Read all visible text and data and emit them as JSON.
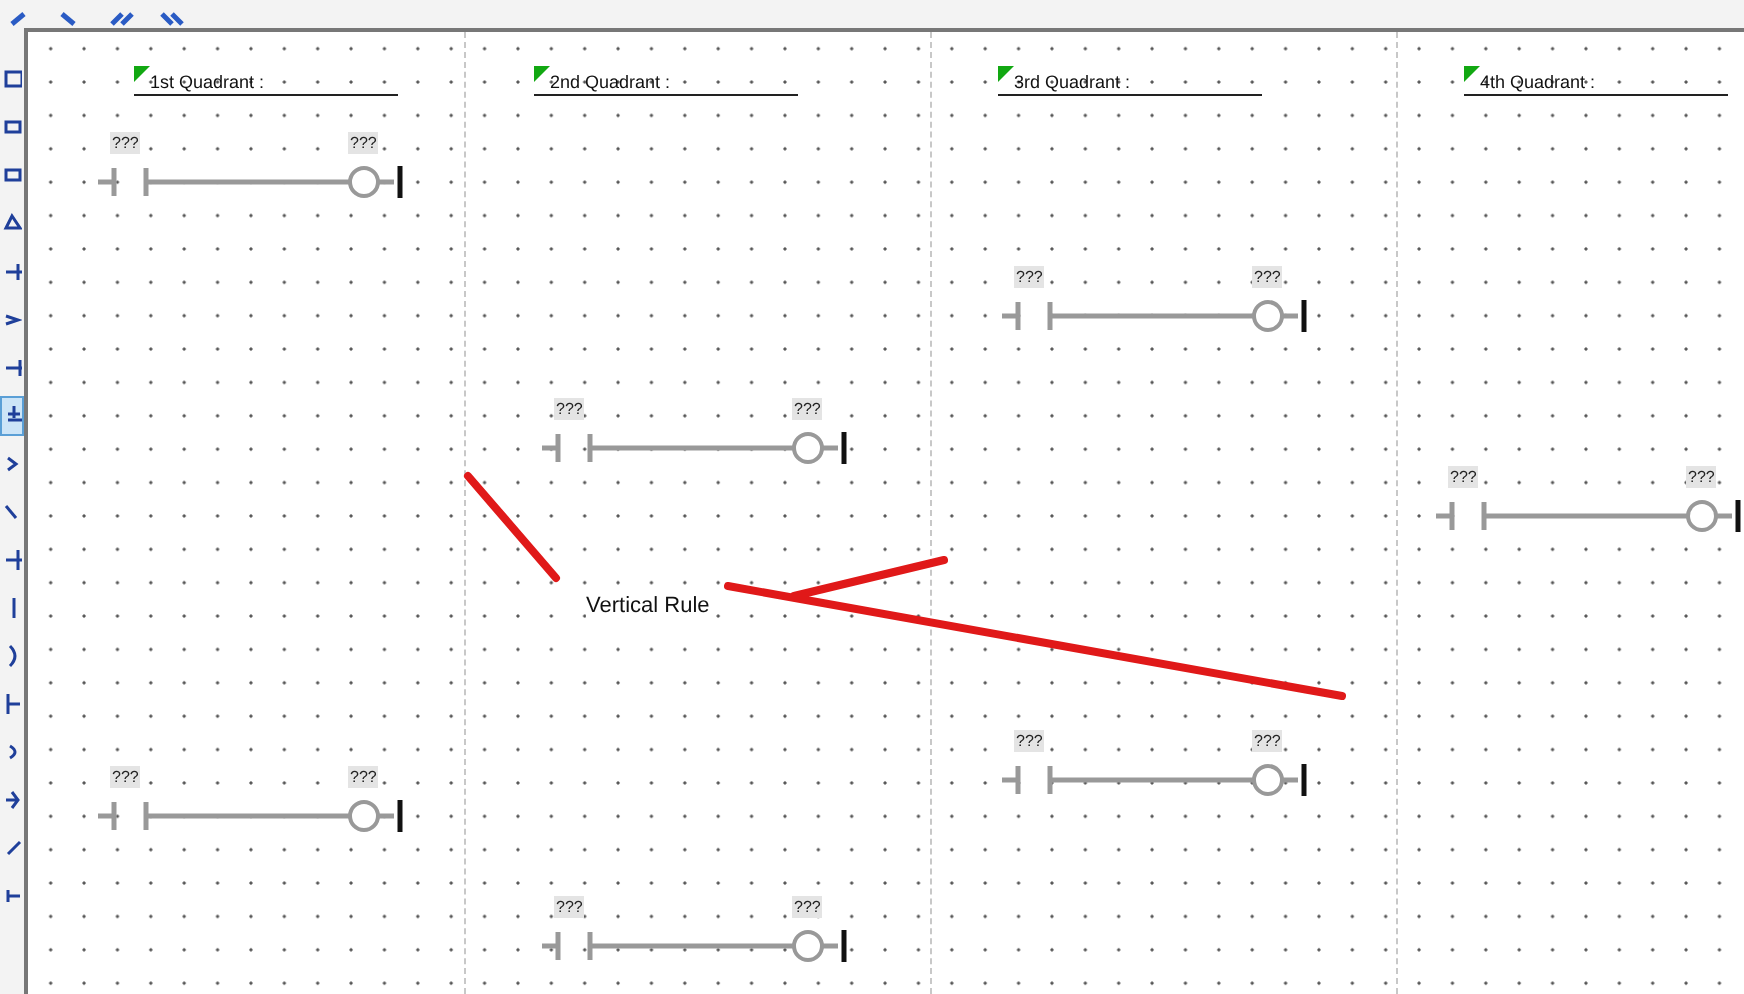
{
  "nav_buttons": [
    {
      "kind": "prev"
    },
    {
      "kind": "next"
    },
    {
      "kind": "first"
    },
    {
      "kind": "last"
    }
  ],
  "tools": [
    {
      "selected": false
    },
    {
      "selected": false
    },
    {
      "selected": false
    },
    {
      "selected": false
    },
    {
      "selected": false
    },
    {
      "selected": false
    },
    {
      "selected": false
    },
    {
      "selected": true
    },
    {
      "selected": false
    },
    {
      "selected": false
    },
    {
      "selected": false
    },
    {
      "selected": false
    },
    {
      "selected": false
    },
    {
      "selected": false
    },
    {
      "selected": false
    },
    {
      "selected": false
    },
    {
      "selected": false
    },
    {
      "selected": false
    }
  ],
  "quadrants": [
    {
      "title": "1st Quadrant :",
      "rungs": [
        {
          "contact_label": "???",
          "coil_label": "???"
        },
        {
          "contact_label": "???",
          "coil_label": "???"
        }
      ]
    },
    {
      "title": "2nd Quadrant :",
      "rungs": [
        {
          "contact_label": "???",
          "coil_label": "???"
        },
        {
          "contact_label": "???",
          "coil_label": "???"
        }
      ]
    },
    {
      "title": "3rd Quadrant :",
      "rungs": [
        {
          "contact_label": "???",
          "coil_label": "???"
        },
        {
          "contact_label": "???",
          "coil_label": "???"
        }
      ]
    },
    {
      "title": "4th Quadrant :",
      "rungs": [
        {
          "contact_label": "???",
          "coil_label": "???"
        }
      ]
    }
  ],
  "annotation": {
    "text": "Vertical Rule"
  }
}
